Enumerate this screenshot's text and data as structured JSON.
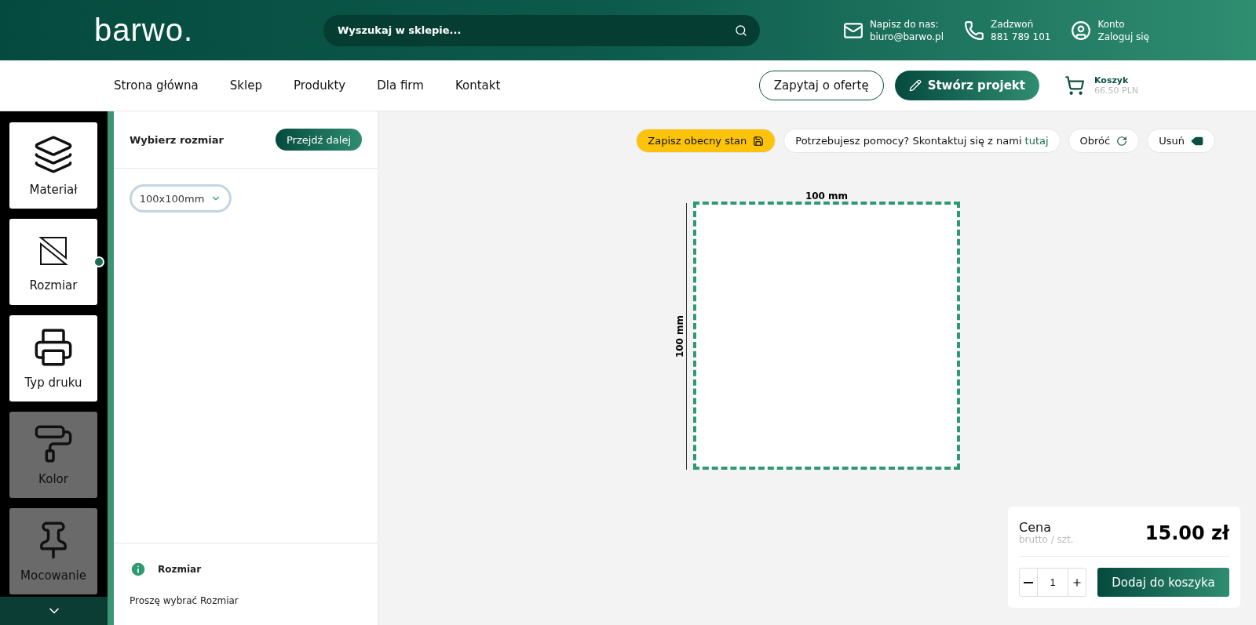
{
  "header": {
    "logo": "barwo.",
    "search": {
      "placeholder": "Wyszukaj w sklepie..."
    },
    "contacts": [
      {
        "kind": "mail",
        "title": "Napisz do nas:",
        "value": "biuro@barwo.pl"
      },
      {
        "kind": "phone",
        "title": "Zadzwoń",
        "value": "881 789 101"
      },
      {
        "kind": "account",
        "title": "Konto",
        "value": "Zaloguj się"
      }
    ]
  },
  "nav": {
    "items": [
      "Strona główna",
      "Sklep",
      "Produkty",
      "Dla firm",
      "Kontakt"
    ],
    "offer_button": "Zapytaj o ofertę",
    "create_button": "Stwórz projekt",
    "cart": {
      "label": "Koszyk",
      "total": "66.50 PLN"
    }
  },
  "steps": [
    {
      "kind": "layers",
      "label": "Materiał",
      "selected": false,
      "disabled": false
    },
    {
      "kind": "size",
      "label": "Rozmiar",
      "selected": true,
      "disabled": false
    },
    {
      "kind": "printer",
      "label": "Typ druku",
      "selected": false,
      "disabled": false
    },
    {
      "kind": "roller",
      "label": "Kolor",
      "selected": false,
      "disabled": true
    },
    {
      "kind": "pin",
      "label": "Mocowanie",
      "selected": false,
      "disabled": true
    }
  ],
  "panel": {
    "title": "Wybierz rozmiar",
    "next_button": "Przejdź dalej",
    "size_select": {
      "value": "100x100mm"
    },
    "info": {
      "title": "Rozmiar",
      "text": "Proszę wybrać Rozmiar"
    }
  },
  "toolbar": {
    "save_button": "Zapisz obecny stan",
    "help_text": "Potrzebujesz pomocy? Skontaktuj się z nami",
    "help_link": "tutaj",
    "rotate_button": "Obróć",
    "delete_button": "Usuń"
  },
  "canvas": {
    "width_label": "100 mm",
    "height_label": "100 mm"
  },
  "price": {
    "label": "Cena",
    "sublabel": "brutto / szt.",
    "value": "15.00 zł",
    "quantity": "1",
    "add_button": "Dodaj do koszyka"
  }
}
